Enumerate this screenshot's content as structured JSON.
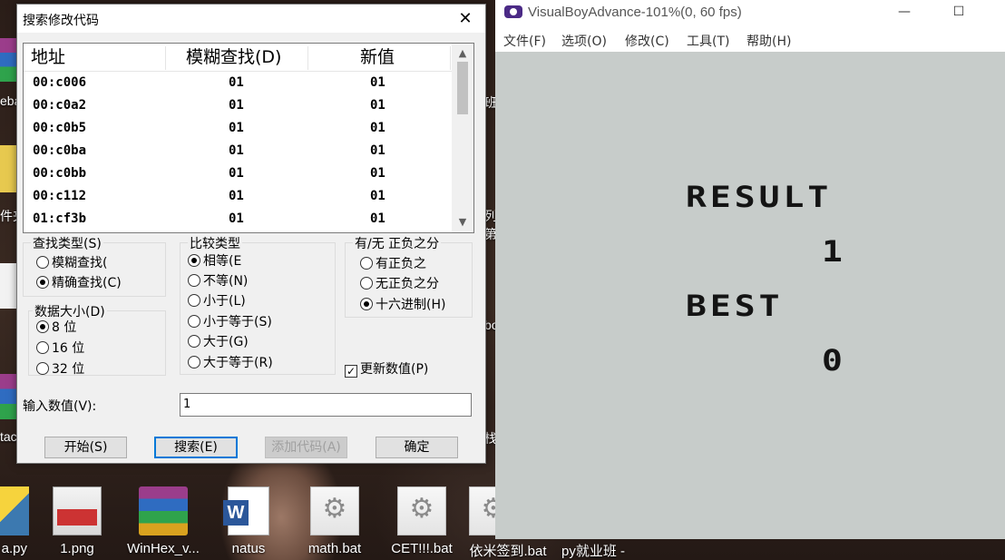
{
  "desktop": {
    "icons": [
      {
        "label": "a.py",
        "glyph": "python-file-icon"
      },
      {
        "label": "1.png",
        "glyph": "png-file-icon"
      },
      {
        "label": "WinHex_v...",
        "glyph": "winrar-archive-icon"
      },
      {
        "label": "natus",
        "glyph": "word-document-icon"
      },
      {
        "label": "math.bat",
        "glyph": "batch-file-icon"
      },
      {
        "label": "CET!!!.bat",
        "glyph": "batch-file-icon"
      },
      {
        "label": "依米签到.bat",
        "glyph": "batch-file-icon"
      },
      {
        "label": "py就业班 -",
        "glyph": "folder-icon"
      }
    ],
    "edge_labels": [
      "eba",
      "件夹",
      "tac"
    ],
    "right_edge_labels": [
      "班",
      "列",
      "第二",
      "bo",
      "栈"
    ]
  },
  "dialog": {
    "title": "搜索修改代码",
    "close_glyph": "✕",
    "list": {
      "columns": [
        "地址",
        "模糊查找(D)",
        "新值"
      ],
      "rows": [
        [
          "00:c006",
          "01",
          "01"
        ],
        [
          "00:c0a2",
          "01",
          "01"
        ],
        [
          "00:c0b5",
          "01",
          "01"
        ],
        [
          "00:c0ba",
          "01",
          "01"
        ],
        [
          "00:c0bb",
          "01",
          "01"
        ],
        [
          "00:c112",
          "01",
          "01"
        ],
        [
          "01:cf3b",
          "01",
          "01"
        ]
      ]
    },
    "search_type": {
      "label": "查找类型(S)",
      "options": [
        {
          "label": "模糊查找(",
          "selected": false
        },
        {
          "label": "精确查找(C)",
          "selected": true
        }
      ]
    },
    "data_size": {
      "label": "数据大小(D)",
      "options": [
        {
          "label": "8 位",
          "selected": true
        },
        {
          "label": "16 位",
          "selected": false
        },
        {
          "label": "32 位",
          "selected": false
        }
      ]
    },
    "compare_type": {
      "label": "比较类型",
      "options": [
        {
          "label": "相等(E",
          "selected": true
        },
        {
          "label": "不等(N)",
          "selected": false
        },
        {
          "label": "小于(L)",
          "selected": false
        },
        {
          "label": "小于等于(S)",
          "selected": false
        },
        {
          "label": "大于(G)",
          "selected": false
        },
        {
          "label": "大于等于(R)",
          "selected": false
        }
      ]
    },
    "signed": {
      "label": "有/无 正负之分",
      "options": [
        {
          "label": "有正负之",
          "selected": false
        },
        {
          "label": "无正负之分",
          "selected": false
        },
        {
          "label": "十六进制(H)",
          "selected": true
        }
      ]
    },
    "update_values": {
      "label": "更新数值(P)",
      "checked": true,
      "check_glyph": "✓"
    },
    "input": {
      "label": "输入数值(V):",
      "value": "1"
    },
    "buttons": {
      "start": "开始(S)",
      "search": "搜索(E)",
      "add_code": "添加代码(A)",
      "ok": "确定"
    }
  },
  "vba": {
    "title": "VisualBoyAdvance-101%(0, 60 fps)",
    "minimize_glyph": "—",
    "maximize_glyph": "☐",
    "menu": [
      "文件(F)",
      "选项(O)",
      "修改(C)",
      "工具(T)",
      "帮助(H)"
    ],
    "game": {
      "result_label": "RESULT",
      "result_value": "1",
      "best_label": "BEST",
      "best_value": "0"
    }
  }
}
